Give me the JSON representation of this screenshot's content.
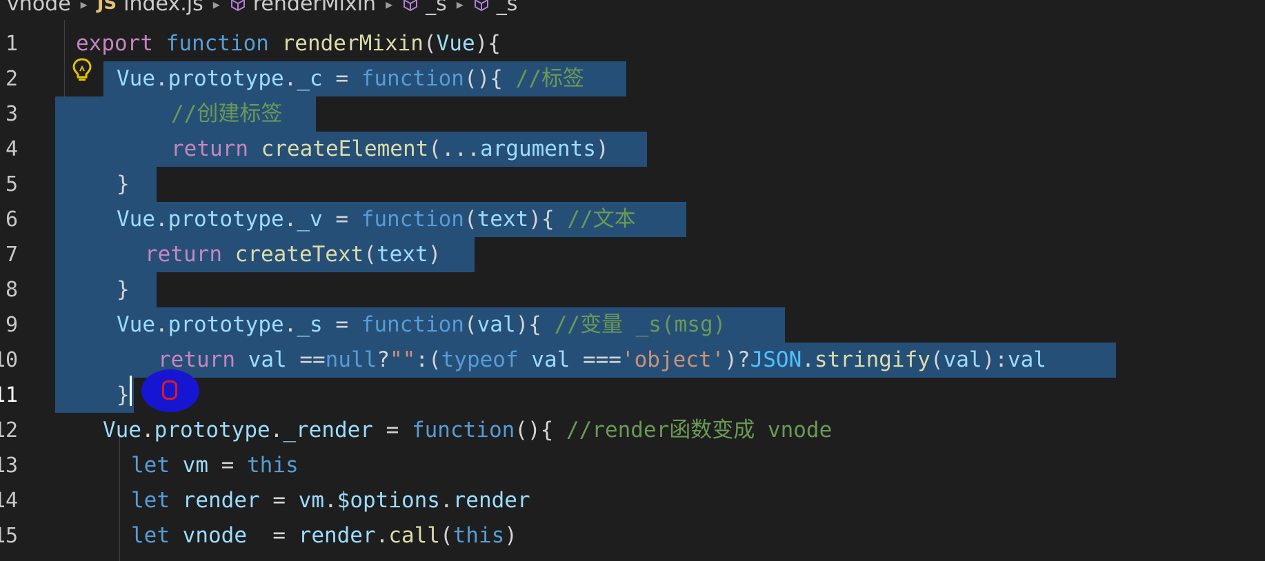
{
  "breadcrumb": {
    "items": [
      "vnode",
      "index.js",
      "renderMixin",
      "_s",
      "_s"
    ],
    "js_badge": "JS"
  },
  "editor": {
    "line_numbers": [
      "1",
      "2",
      "3",
      "4",
      "5",
      "6",
      "7",
      "8",
      "9",
      "10",
      "11",
      "12",
      "13",
      "14",
      "15"
    ],
    "active_line": 11,
    "lines": [
      {
        "tokens": [
          {
            "t": "export",
            "c": "kw"
          },
          {
            "t": " ",
            "c": "pl"
          },
          {
            "t": "function",
            "c": "st"
          },
          {
            "t": " ",
            "c": "pl"
          },
          {
            "t": "renderMixin",
            "c": "fn"
          },
          {
            "t": "(",
            "c": "pl"
          },
          {
            "t": "Vue",
            "c": "id"
          },
          {
            "t": "){",
            "c": "pl"
          }
        ]
      },
      {
        "tokens": [
          {
            "t": "Vue",
            "c": "id"
          },
          {
            "t": ".",
            "c": "pl"
          },
          {
            "t": "prototype",
            "c": "id"
          },
          {
            "t": ".",
            "c": "pl"
          },
          {
            "t": "_c",
            "c": "id"
          },
          {
            "t": " = ",
            "c": "pl"
          },
          {
            "t": "function",
            "c": "st"
          },
          {
            "t": "(){ ",
            "c": "pl"
          },
          {
            "t": "//标签",
            "c": "cm"
          }
        ]
      },
      {
        "tokens": [
          {
            "t": "//创建标签",
            "c": "cm"
          }
        ]
      },
      {
        "tokens": [
          {
            "t": "return",
            "c": "kw"
          },
          {
            "t": " ",
            "c": "pl"
          },
          {
            "t": "createElement",
            "c": "fn"
          },
          {
            "t": "(...",
            "c": "pl"
          },
          {
            "t": "arguments",
            "c": "id"
          },
          {
            "t": ")",
            "c": "pl"
          }
        ]
      },
      {
        "tokens": [
          {
            "t": "}",
            "c": "pl"
          }
        ]
      },
      {
        "tokens": [
          {
            "t": "Vue",
            "c": "id"
          },
          {
            "t": ".",
            "c": "pl"
          },
          {
            "t": "prototype",
            "c": "id"
          },
          {
            "t": ".",
            "c": "pl"
          },
          {
            "t": "_v",
            "c": "id"
          },
          {
            "t": " = ",
            "c": "pl"
          },
          {
            "t": "function",
            "c": "st"
          },
          {
            "t": "(",
            "c": "pl"
          },
          {
            "t": "text",
            "c": "id"
          },
          {
            "t": "){ ",
            "c": "pl"
          },
          {
            "t": "//文本",
            "c": "cm"
          }
        ]
      },
      {
        "tokens": [
          {
            "t": "return",
            "c": "kw"
          },
          {
            "t": " ",
            "c": "pl"
          },
          {
            "t": "createText",
            "c": "fn"
          },
          {
            "t": "(",
            "c": "pl"
          },
          {
            "t": "text",
            "c": "id"
          },
          {
            "t": ")",
            "c": "pl"
          }
        ]
      },
      {
        "tokens": [
          {
            "t": "}",
            "c": "pl"
          }
        ]
      },
      {
        "tokens": [
          {
            "t": "Vue",
            "c": "id"
          },
          {
            "t": ".",
            "c": "pl"
          },
          {
            "t": "prototype",
            "c": "id"
          },
          {
            "t": ".",
            "c": "pl"
          },
          {
            "t": "_s",
            "c": "id"
          },
          {
            "t": " = ",
            "c": "pl"
          },
          {
            "t": "function",
            "c": "st"
          },
          {
            "t": "(",
            "c": "pl"
          },
          {
            "t": "val",
            "c": "id"
          },
          {
            "t": "){ ",
            "c": "pl"
          },
          {
            "t": "//变量 _s(msg)",
            "c": "cm"
          }
        ]
      },
      {
        "tokens": [
          {
            "t": "return",
            "c": "kw"
          },
          {
            "t": " ",
            "c": "pl"
          },
          {
            "t": "val",
            "c": "id"
          },
          {
            "t": " ==",
            "c": "pl"
          },
          {
            "t": "null",
            "c": "st"
          },
          {
            "t": "?",
            "c": "pl"
          },
          {
            "t": "\"\"",
            "c": "str"
          },
          {
            "t": ":(",
            "c": "pl"
          },
          {
            "t": "typeof",
            "c": "st"
          },
          {
            "t": " ",
            "c": "pl"
          },
          {
            "t": "val",
            "c": "id"
          },
          {
            "t": " ===",
            "c": "pl"
          },
          {
            "t": "'object'",
            "c": "str"
          },
          {
            "t": ")?",
            "c": "pl"
          },
          {
            "t": "JSON",
            "c": "cn"
          },
          {
            "t": ".",
            "c": "pl"
          },
          {
            "t": "stringify",
            "c": "fn"
          },
          {
            "t": "(",
            "c": "pl"
          },
          {
            "t": "val",
            "c": "id"
          },
          {
            "t": "):",
            "c": "pl"
          },
          {
            "t": "val",
            "c": "id"
          }
        ]
      },
      {
        "tokens": [
          {
            "t": "}",
            "c": "pl"
          }
        ]
      },
      {
        "tokens": [
          {
            "t": "Vue",
            "c": "id"
          },
          {
            "t": ".",
            "c": "pl"
          },
          {
            "t": "prototype",
            "c": "id"
          },
          {
            "t": ".",
            "c": "pl"
          },
          {
            "t": "_render",
            "c": "id"
          },
          {
            "t": " = ",
            "c": "pl"
          },
          {
            "t": "function",
            "c": "st"
          },
          {
            "t": "(){ ",
            "c": "pl"
          },
          {
            "t": "//render函数变成 vnode",
            "c": "cm"
          }
        ]
      },
      {
        "tokens": [
          {
            "t": "let",
            "c": "st"
          },
          {
            "t": " ",
            "c": "pl"
          },
          {
            "t": "vm",
            "c": "id"
          },
          {
            "t": " = ",
            "c": "pl"
          },
          {
            "t": "this",
            "c": "st"
          }
        ]
      },
      {
        "tokens": [
          {
            "t": "let",
            "c": "st"
          },
          {
            "t": " ",
            "c": "pl"
          },
          {
            "t": "render",
            "c": "id"
          },
          {
            "t": " = ",
            "c": "pl"
          },
          {
            "t": "vm",
            "c": "id"
          },
          {
            "t": ".",
            "c": "pl"
          },
          {
            "t": "$options",
            "c": "id"
          },
          {
            "t": ".",
            "c": "pl"
          },
          {
            "t": "render",
            "c": "id"
          }
        ]
      },
      {
        "tokens": [
          {
            "t": "let",
            "c": "st"
          },
          {
            "t": " ",
            "c": "pl"
          },
          {
            "t": "vnode",
            "c": "id"
          },
          {
            "t": "  = ",
            "c": "pl"
          },
          {
            "t": "render",
            "c": "id"
          },
          {
            "t": ".",
            "c": "pl"
          },
          {
            "t": "call",
            "c": "fn"
          },
          {
            "t": "(",
            "c": "pl"
          },
          {
            "t": "this",
            "c": "st"
          },
          {
            "t": ")",
            "c": "pl"
          }
        ]
      }
    ]
  },
  "icons": [
    "chevron-right-icon",
    "symbol-method-icon",
    "lightbulb-icon"
  ],
  "colors": {
    "background": "#1e1e1e",
    "selection": "#264f78",
    "keyword": "#c586c0",
    "function": "#dcdcaa",
    "storage": "#569cd6",
    "variable": "#9cdcfe",
    "comment": "#6a9955",
    "string": "#ce9178"
  }
}
